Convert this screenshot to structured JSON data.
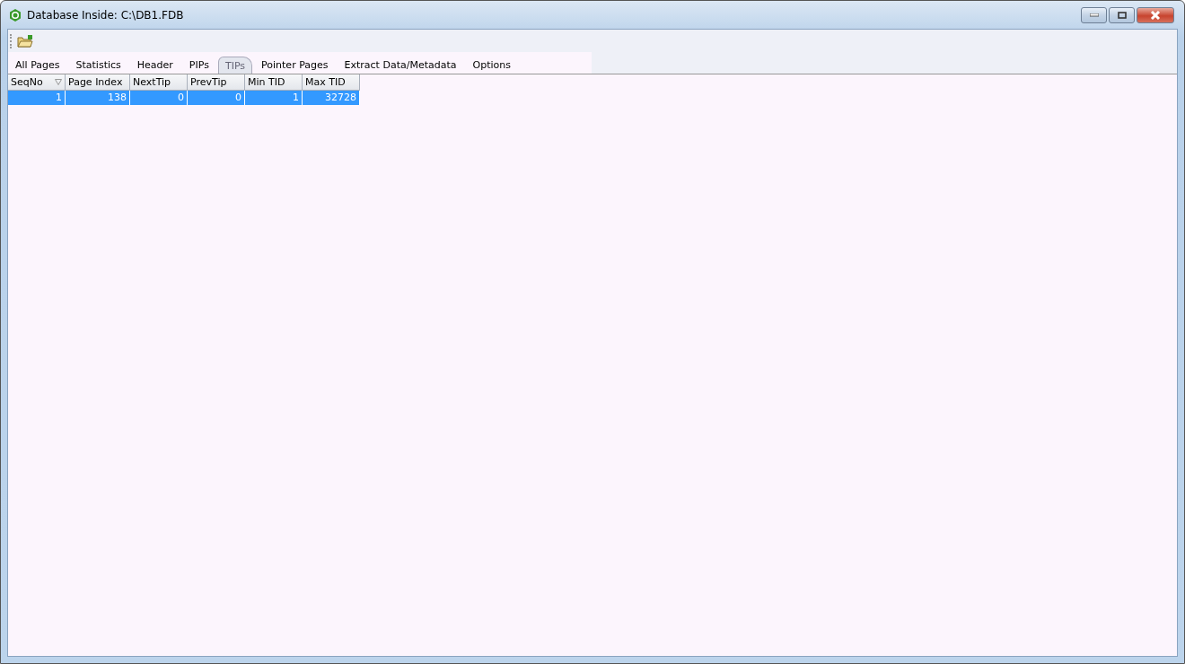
{
  "window": {
    "title": "Database Inside: C:\\DB1.FDB"
  },
  "tabs": [
    {
      "label": "All Pages",
      "selected": false
    },
    {
      "label": "Statistics",
      "selected": false
    },
    {
      "label": "Header",
      "selected": false
    },
    {
      "label": "PIPs",
      "selected": false
    },
    {
      "label": "TIPs",
      "selected": true
    },
    {
      "label": "Pointer Pages",
      "selected": false
    },
    {
      "label": "Extract Data/Metadata",
      "selected": false
    },
    {
      "label": "Options",
      "selected": false
    }
  ],
  "table": {
    "columns": [
      {
        "label": "SeqNo",
        "sorted": true
      },
      {
        "label": "Page Index",
        "sorted": false
      },
      {
        "label": "NextTip",
        "sorted": false
      },
      {
        "label": "PrevTip",
        "sorted": false
      },
      {
        "label": "Min TID",
        "sorted": false
      },
      {
        "label": "Max TID",
        "sorted": false
      }
    ],
    "rows": [
      {
        "selected": true,
        "cells": [
          "1",
          "138",
          "0",
          "0",
          "1",
          "32728"
        ]
      }
    ]
  }
}
